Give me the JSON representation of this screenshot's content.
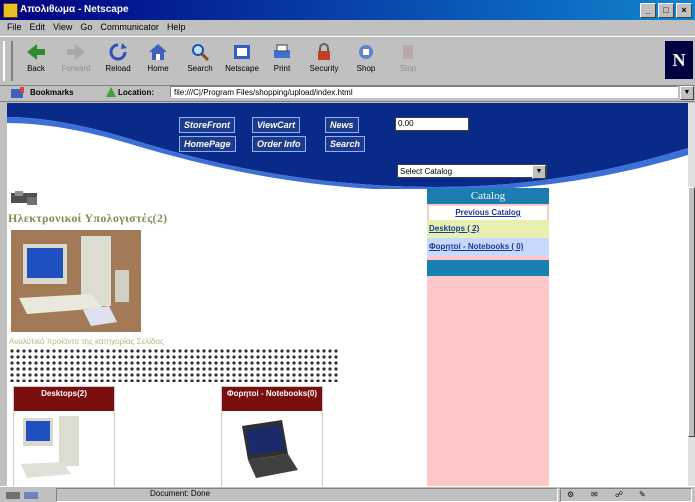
{
  "window": {
    "title": "Απολιθωμα - Netscape"
  },
  "menu": [
    "File",
    "Edit",
    "View",
    "Go",
    "Communicator",
    "Help"
  ],
  "toolbar": [
    {
      "label": "Back",
      "icon": "back-arrow-icon",
      "enabled": true
    },
    {
      "label": "Forward",
      "icon": "forward-arrow-icon",
      "enabled": false
    },
    {
      "label": "Reload",
      "icon": "reload-icon",
      "enabled": true
    },
    {
      "label": "Home",
      "icon": "home-icon",
      "enabled": true
    },
    {
      "label": "Search",
      "icon": "search-icon",
      "enabled": true
    },
    {
      "label": "Netscape",
      "icon": "netscape-icon",
      "enabled": true
    },
    {
      "label": "Print",
      "icon": "print-icon",
      "enabled": true
    },
    {
      "label": "Security",
      "icon": "security-icon",
      "enabled": true
    },
    {
      "label": "Shop",
      "icon": "shop-icon",
      "enabled": true
    },
    {
      "label": "Stop",
      "icon": "stop-icon",
      "enabled": false
    }
  ],
  "location": {
    "bookmarks_label": "Bookmarks",
    "label": "Location:",
    "url": "file:///C|/Program Files/shopping/upload/index.html"
  },
  "store": {
    "nav": [
      "StoreFront",
      "ViewCart",
      "News",
      "HomePage",
      "Order Info",
      "Search"
    ],
    "qty_value": "0.00",
    "select_catalog": "Select Catalog",
    "section_title": "Ηλεκτρονικοί Υπολογιστές(2)",
    "promo_text": "Αναλυτικά προϊόντα της κατηγορίας Σελίδας",
    "products": [
      {
        "name": "Desktops(2)"
      },
      {
        "name": "Φορητοί - Notebooks(0)"
      }
    ]
  },
  "catalog": {
    "title": "Catalog",
    "previous": "Previous Catalog",
    "items": [
      "Desktops ( 2)",
      "Φορητοί - Notebooks ( 0)"
    ]
  },
  "status": {
    "text": "Document: Done"
  },
  "colors": {
    "title_bar": "#000080",
    "catalog_head": "#1a7fb0",
    "catalog_bg": "#ffc8c8",
    "product_head": "#7a0d0d"
  }
}
